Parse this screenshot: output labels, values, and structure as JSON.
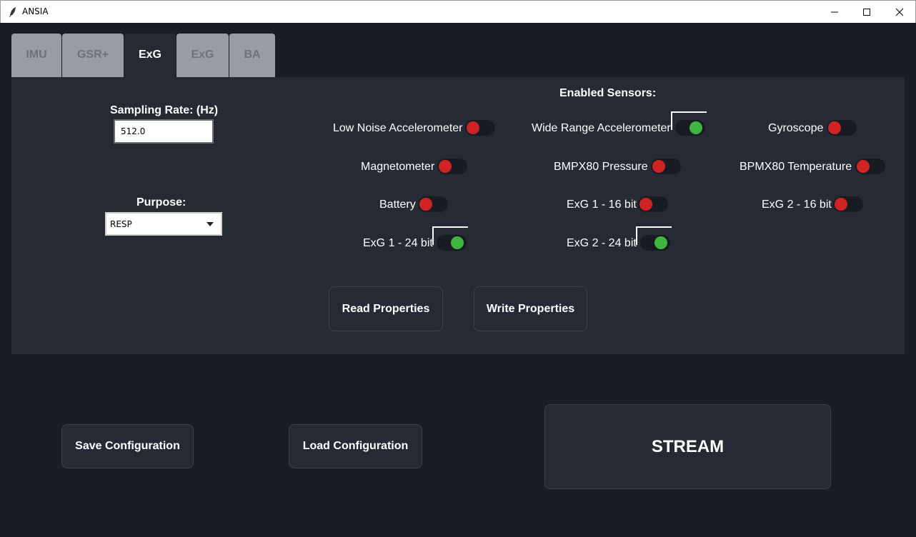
{
  "window": {
    "title": "ANSIA"
  },
  "tabs": [
    {
      "label": "IMU"
    },
    {
      "label": "GSR+"
    },
    {
      "label": "ExG"
    },
    {
      "label": "ExG"
    },
    {
      "label": "BA"
    }
  ],
  "active_tab_index": 2,
  "sampling": {
    "label": "Sampling Rate: (Hz)",
    "value": "512.0"
  },
  "purpose": {
    "label": "Purpose:",
    "selected": "RESP"
  },
  "sensors_heading": "Enabled Sensors:",
  "sensors": [
    {
      "label": "Low Noise Accelerometer",
      "enabled": false
    },
    {
      "label": "Wide Range Accelerometer",
      "enabled": true
    },
    {
      "label": "Gyroscope",
      "enabled": false
    },
    {
      "label": "Magnetometer",
      "enabled": false
    },
    {
      "label": "BMPX80 Pressure",
      "enabled": false
    },
    {
      "label": "BPMX80 Temperature",
      "enabled": false
    },
    {
      "label": "Battery",
      "enabled": false
    },
    {
      "label": "ExG 1 - 16 bit",
      "enabled": false
    },
    {
      "label": "ExG 2 - 16 bit",
      "enabled": false
    },
    {
      "label": "ExG 1 - 24 bit",
      "enabled": true
    },
    {
      "label": "ExG 2 - 24 bit",
      "enabled": true
    }
  ],
  "buttons": {
    "read": "Read Properties",
    "write": "Write Properties",
    "save": "Save Configuration",
    "load": "Load Configuration",
    "stream": "STREAM"
  },
  "colors": {
    "background": "#1a1d26",
    "panel": "#262a34",
    "toggle_on": "#3fb53f",
    "toggle_off": "#d02424"
  },
  "icons": {
    "app": "feather-icon",
    "minimize": "minimize-icon",
    "maximize": "maximize-icon",
    "close": "close-icon"
  }
}
